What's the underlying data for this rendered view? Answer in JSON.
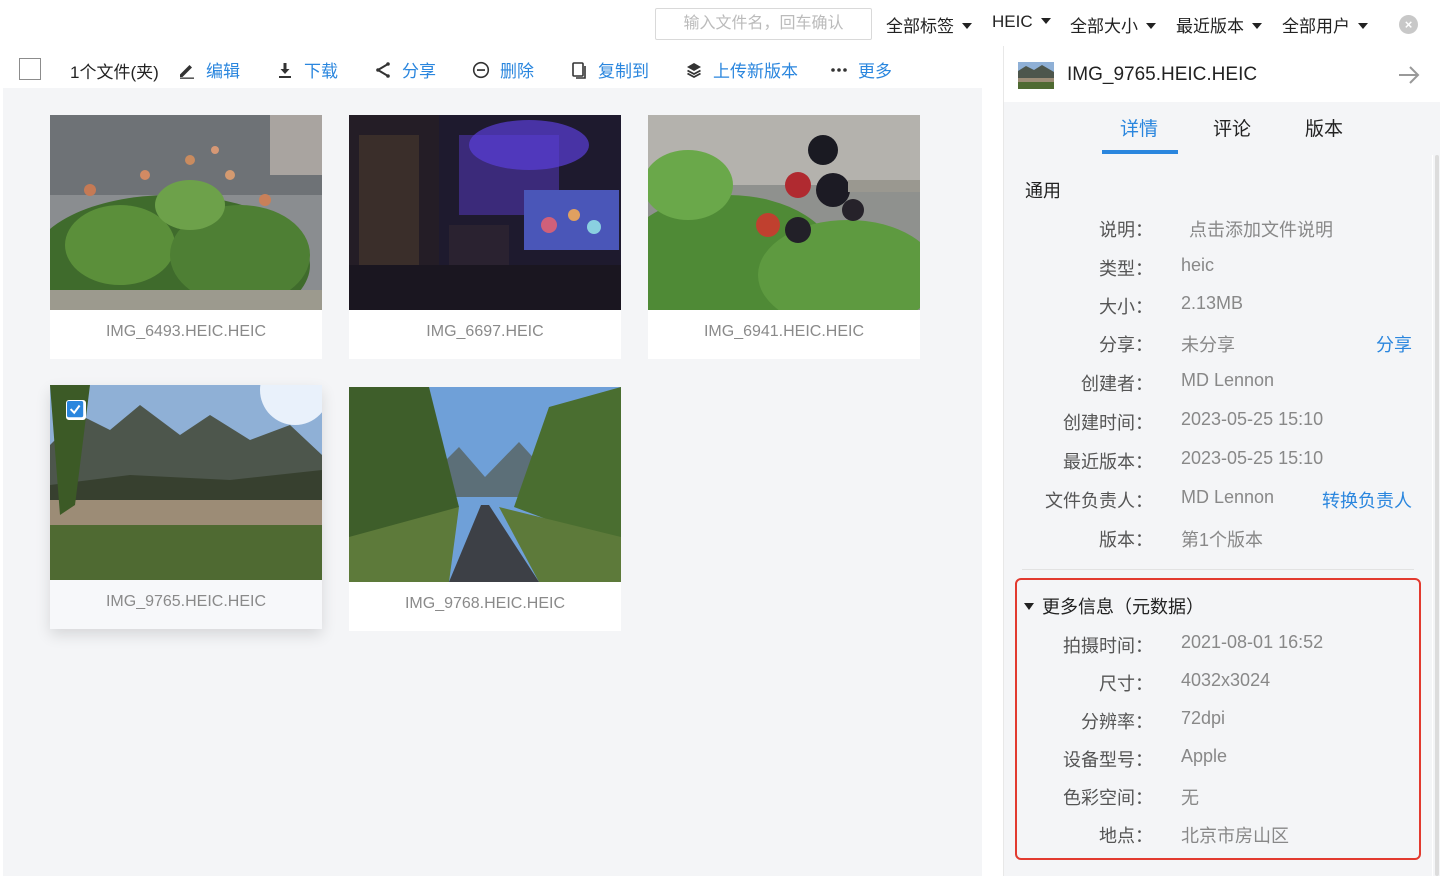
{
  "filters": {
    "search_placeholder": "输入文件名，回车确认",
    "tag": "全部标签",
    "type": "HEIC",
    "size": "全部大小",
    "version": "最近版本",
    "user": "全部用户"
  },
  "toolbar": {
    "count": "1个文件(夹)",
    "edit": "编辑",
    "download": "下载",
    "share": "分享",
    "delete": "删除",
    "copy": "复制到",
    "upload_version": "上传新版本",
    "more": "更多"
  },
  "files": [
    {
      "name": "IMG_6493.HEIC.HEIC",
      "selected": false
    },
    {
      "name": "IMG_6697.HEIC",
      "selected": false
    },
    {
      "name": "IMG_6941.HEIC.HEIC",
      "selected": false
    },
    {
      "name": "IMG_9765.HEIC.HEIC",
      "selected": true
    },
    {
      "name": "IMG_9768.HEIC.HEIC",
      "selected": false
    }
  ],
  "panel": {
    "title": "IMG_9765.HEIC.HEIC",
    "tabs": [
      "详情",
      "评论",
      "版本"
    ],
    "active_tab": "详情",
    "section": "通用",
    "details": [
      {
        "label": "说明：",
        "value": "点击添加文件说明"
      },
      {
        "label": "类型：",
        "value": "heic"
      },
      {
        "label": "大小：",
        "value": "2.13MB"
      },
      {
        "label": "分享：",
        "value": "未分享",
        "action": "分享"
      },
      {
        "label": "创建者：",
        "value": "MD Lennon"
      },
      {
        "label": "创建时间：",
        "value": "2023-05-25 15:10"
      },
      {
        "label": "最近版本：",
        "value": "2023-05-25 15:10"
      },
      {
        "label": "文件负责人：",
        "value": "MD Lennon",
        "action": "转换负责人"
      },
      {
        "label": "版本：",
        "value": "第1个版本"
      }
    ],
    "meta_title": "更多信息（元数据）",
    "metadata": [
      {
        "label": "拍摄时间：",
        "value": "2021-08-01 16:52"
      },
      {
        "label": "尺寸：",
        "value": "4032x3024"
      },
      {
        "label": "分辨率：",
        "value": "72dpi"
      },
      {
        "label": "设备型号：",
        "value": "Apple"
      },
      {
        "label": "色彩空间：",
        "value": "无"
      },
      {
        "label": "地点：",
        "value": "北京市房山区"
      }
    ]
  },
  "colors": {
    "accent": "#2a86de",
    "highlight_border": "#e23a2f",
    "panel_bg": "#f4f5f7"
  }
}
